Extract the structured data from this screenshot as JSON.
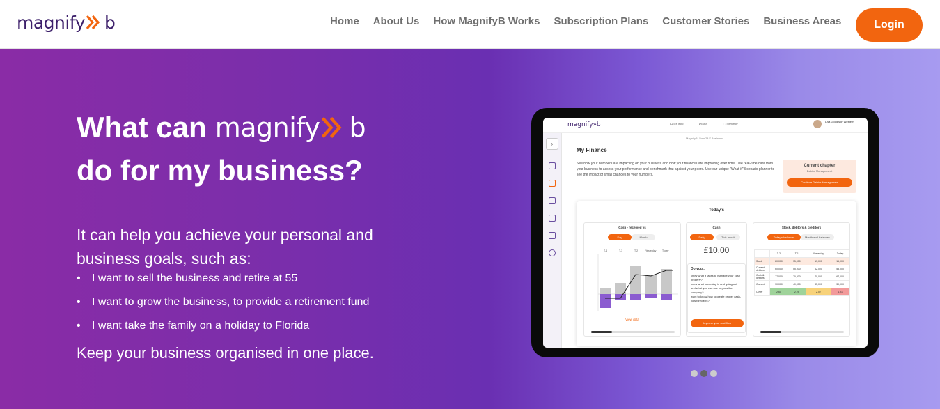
{
  "nav": {
    "logo": {
      "text_before": "magnify",
      "text_after": "b"
    },
    "links": [
      "Home",
      "About Us",
      "How MagnifyB Works",
      "Subscription Plans",
      "Customer Stories",
      "Business Areas"
    ],
    "login_label": "Login"
  },
  "hero": {
    "headline_part1": "What can",
    "headline_logo": {
      "text_before": "magnify",
      "text_after": "b"
    },
    "headline_part2": "do for my business?",
    "lead": "It can help you achieve your personal and business goals, such as:",
    "goals": [
      "I want to sell the business and retire at 55",
      "I want to grow the business, to provide a retirement fund",
      "I want take the family on a holiday to Florida"
    ],
    "tagline": "Keep your business organised in one place."
  },
  "tablet": {
    "logo": "magnify»b",
    "tabs": [
      "Features",
      "Plans",
      "Customer"
    ],
    "username": "Lisa Goodison Western",
    "subtitle": "MagnifyB: Your 24/7 Business",
    "title": "My Finance",
    "description": "See how your numbers are impacting on your business and how your finances are improving over time. Use real-time data from your business to assess your performance and benchmark that against your peers. Use our unique \"What-if\" Scenario planner to see the impact of small changes to your numbers.",
    "chapter": {
      "title": "Current chapter",
      "subtitle": "Debtor Management",
      "button": "Continue Debtor Management"
    },
    "today": "Today's",
    "cash_chart": {
      "title": "Cash - received vs",
      "pills": [
        "Day",
        "Month"
      ],
      "columns": [
        "T-4",
        "T-3",
        "T-2",
        "Yesterday",
        "Today"
      ],
      "view_data": "View data"
    },
    "cash": {
      "title": "Cash",
      "pills": [
        "Daily",
        "This month"
      ],
      "value": "£10,00",
      "doyou_title": "Do you...",
      "doyou_lines": [
        "know what it takes to manage your cash properly?",
        "know what is coming in and going out and what you can use to grow the company?",
        "want to know how to create proper cash-flow forecasts?"
      ],
      "button": "Improve your cashflow"
    },
    "stock": {
      "title": "Stock, debtors & creditors",
      "pills": [
        "Today's balances",
        "Month end balances"
      ],
      "headers": [
        "",
        "T-2",
        "T-1",
        "Yesterday",
        "Today"
      ],
      "rows": [
        {
          "label": "Stock",
          "values": [
            "20,000",
            "15,000",
            "17,000",
            "16,000"
          ]
        },
        {
          "label": "Current debtors",
          "values": [
            "60,000",
            "55,000",
            "62,000",
            "58,000"
          ]
        },
        {
          "label": "Cash & debtors",
          "values": [
            "77,000",
            "70,000",
            "70,000",
            "67,000"
          ]
        },
        {
          "label": "Current",
          "values": [
            "30,000",
            "40,000",
            "35,000",
            "30,000"
          ]
        },
        {
          "label": "Cover",
          "values": [
            "2.60",
            "2.25",
            "2.02",
            "1.91"
          ]
        }
      ],
      "cover_colors": [
        "#9fd39a",
        "#9fd39a",
        "#f7d27a",
        "#f29a9a"
      ]
    }
  },
  "carousel": {
    "slides": 3,
    "active": 2
  },
  "colors": {
    "accent": "#f2650f",
    "brand_purple": "#3c1f6a"
  }
}
